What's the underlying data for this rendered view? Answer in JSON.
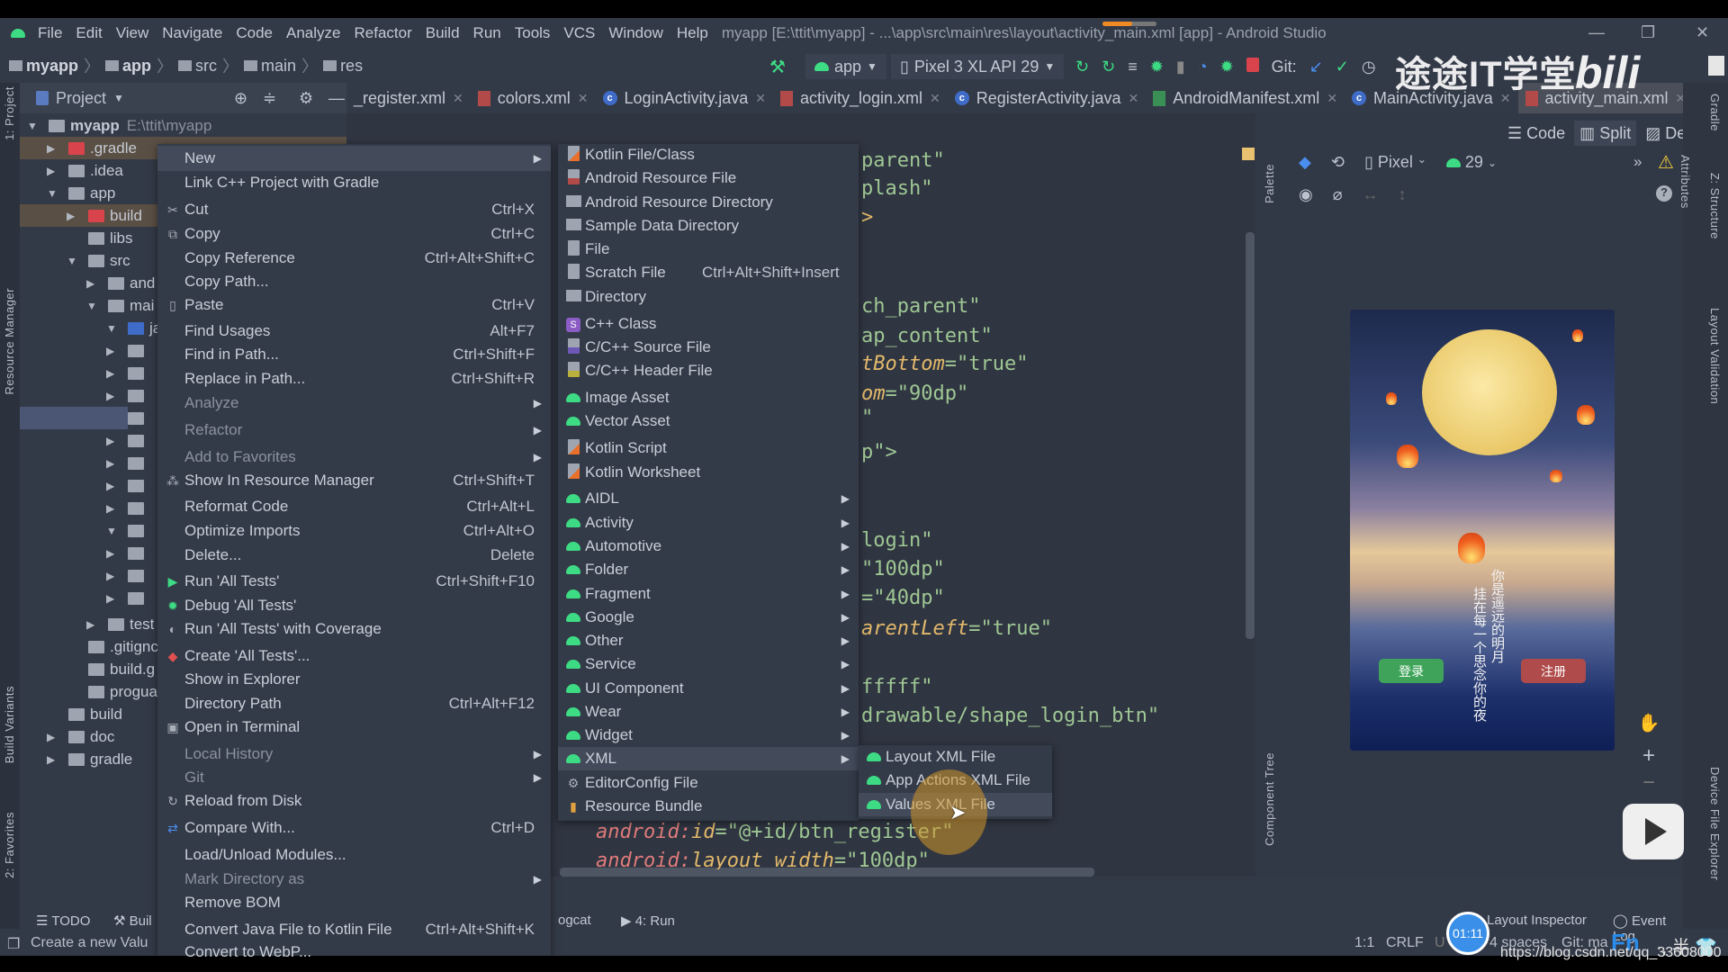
{
  "window": {
    "title": "myapp [E:\\ttit\\myapp] - ...\\app\\src\\main\\res\\layout\\activity_main.xml [app] - Android Studio",
    "controls": [
      "—",
      "❐",
      "✕"
    ]
  },
  "menubar": [
    "File",
    "Edit",
    "View",
    "Navigate",
    "Code",
    "Analyze",
    "Refactor",
    "Build",
    "Run",
    "Tools",
    "VCS",
    "Window",
    "Help"
  ],
  "breadcrumb": [
    "myapp",
    "app",
    "src",
    "main",
    "res"
  ],
  "toolbar": {
    "config": "app",
    "device": "Pixel 3 XL API 29",
    "git_label": "Git:"
  },
  "project_panel": {
    "title": "Project",
    "root_name": "myapp",
    "root_path": "E:\\ttit\\myapp",
    "tree": [
      ".gradle",
      ".idea",
      "app",
      "build",
      "libs",
      "src",
      "and",
      "mai",
      "ja",
      "test",
      ".gitignc",
      "build.g",
      "progua",
      "build",
      "doc",
      "gradle"
    ]
  },
  "tabs": [
    {
      "label": "_register.xml",
      "icon": "xml"
    },
    {
      "label": "colors.xml",
      "icon": "xml"
    },
    {
      "label": "LoginActivity.java",
      "icon": "class"
    },
    {
      "label": "activity_login.xml",
      "icon": "xml"
    },
    {
      "label": "RegisterActivity.java",
      "icon": "class"
    },
    {
      "label": "AndroidManifest.xml",
      "icon": "manifest"
    },
    {
      "label": "MainActivity.java",
      "icon": "class"
    },
    {
      "label": "activity_main.xml",
      "icon": "xml",
      "active": true
    }
  ],
  "context_menu": [
    {
      "label": "New",
      "submenu": true,
      "selected": true
    },
    {
      "label": "Link C++ Project with Gradle"
    },
    {
      "label": "Cut",
      "shortcut": "Ctrl+X",
      "icon": "scissors"
    },
    {
      "label": "Copy",
      "shortcut": "Ctrl+C",
      "icon": "copy"
    },
    {
      "label": "Copy Reference",
      "shortcut": "Ctrl+Alt+Shift+C"
    },
    {
      "label": "Copy Path..."
    },
    {
      "label": "Paste",
      "shortcut": "Ctrl+V",
      "icon": "clipboard"
    },
    {
      "label": "Find Usages",
      "shortcut": "Alt+F7"
    },
    {
      "label": "Find in Path...",
      "shortcut": "Ctrl+Shift+F"
    },
    {
      "label": "Replace in Path...",
      "shortcut": "Ctrl+Shift+R"
    },
    {
      "label": "Analyze",
      "submenu": true,
      "disabled": true
    },
    {
      "label": "Refactor",
      "submenu": true,
      "disabled": true
    },
    {
      "label": "Add to Favorites",
      "submenu": true,
      "disabled": true
    },
    {
      "label": "Show In Resource Manager",
      "shortcut": "Ctrl+Shift+T",
      "icon": "resource-manager"
    },
    {
      "label": "Reformat Code",
      "shortcut": "Ctrl+Alt+L"
    },
    {
      "label": "Optimize Imports",
      "shortcut": "Ctrl+Alt+O"
    },
    {
      "label": "Delete...",
      "shortcut": "Delete"
    },
    {
      "label": "Run 'All Tests'",
      "shortcut": "Ctrl+Shift+F10",
      "icon": "run"
    },
    {
      "label": "Debug 'All Tests'",
      "icon": "debug"
    },
    {
      "label": "Run 'All Tests' with Coverage",
      "icon": "coverage"
    },
    {
      "label": "Create 'All Tests'...",
      "icon": "create-test"
    },
    {
      "label": "Show in Explorer"
    },
    {
      "label": "Directory Path",
      "shortcut": "Ctrl+Alt+F12"
    },
    {
      "label": "Open in Terminal",
      "icon": "terminal"
    },
    {
      "label": "Local History",
      "submenu": true,
      "disabled": true
    },
    {
      "label": "Git",
      "submenu": true,
      "disabled": true
    },
    {
      "label": "Reload from Disk",
      "icon": "reload"
    },
    {
      "label": "Compare With...",
      "shortcut": "Ctrl+D",
      "icon": "compare"
    },
    {
      "label": "Load/Unload Modules..."
    },
    {
      "label": "Mark Directory as",
      "submenu": true,
      "disabled": true
    },
    {
      "label": "Remove BOM"
    },
    {
      "label": "Convert Java File to Kotlin File",
      "shortcut": "Ctrl+Alt+Shift+K"
    },
    {
      "label": "Convert to WebP..."
    }
  ],
  "new_submenu": [
    {
      "label": "Kotlin File/Class",
      "icon": "kotlin"
    },
    {
      "label": "Android Resource File",
      "icon": "xml"
    },
    {
      "label": "Android Resource Directory",
      "icon": "folder"
    },
    {
      "label": "Sample Data Directory",
      "icon": "folder"
    },
    {
      "label": "File",
      "icon": "file"
    },
    {
      "label": "Scratch File",
      "shortcut": "Ctrl+Alt+Shift+Insert",
      "icon": "scratch"
    },
    {
      "label": "Directory",
      "icon": "folder"
    },
    {
      "label": "C++ Class",
      "icon": "cpp-class"
    },
    {
      "label": "C/C++ Source File",
      "icon": "cpp"
    },
    {
      "label": "C/C++ Header File",
      "icon": "header"
    },
    {
      "label": "Image Asset",
      "icon": "android"
    },
    {
      "label": "Vector Asset",
      "icon": "android"
    },
    {
      "label": "Kotlin Script",
      "icon": "kotlin"
    },
    {
      "label": "Kotlin Worksheet",
      "icon": "kotlin"
    },
    {
      "label": "AIDL",
      "icon": "android",
      "submenu": true
    },
    {
      "label": "Activity",
      "icon": "android",
      "submenu": true
    },
    {
      "label": "Automotive",
      "icon": "android",
      "submenu": true
    },
    {
      "label": "Folder",
      "icon": "android",
      "submenu": true
    },
    {
      "label": "Fragment",
      "icon": "android",
      "submenu": true
    },
    {
      "label": "Google",
      "icon": "android",
      "submenu": true
    },
    {
      "label": "Other",
      "icon": "android",
      "submenu": true
    },
    {
      "label": "Service",
      "icon": "android",
      "submenu": true
    },
    {
      "label": "UI Component",
      "icon": "android",
      "submenu": true
    },
    {
      "label": "Wear",
      "icon": "android",
      "submenu": true
    },
    {
      "label": "Widget",
      "icon": "android",
      "submenu": true
    },
    {
      "label": "XML",
      "icon": "android",
      "submenu": true,
      "selected": true
    },
    {
      "label": "EditorConfig File",
      "icon": "gear"
    },
    {
      "label": "Resource Bundle",
      "icon": "bundle"
    }
  ],
  "xml_submenu": [
    {
      "label": "Layout XML File"
    },
    {
      "label": "App Actions XML File"
    },
    {
      "label": "Values XML File",
      "selected": true
    }
  ],
  "code_fragments": [
    [
      "parent\""
    ],
    [
      "plash\""
    ],
    [
      ">"
    ],
    [
      "ch_parent\""
    ],
    [
      "ap_content\""
    ],
    [
      "tBottom",
      "=\"true\""
    ],
    [
      "om",
      "=\"90dp\""
    ],
    [
      "\""
    ],
    [
      "p\">"
    ],
    [
      "login\""
    ],
    [
      "\"100dp\""
    ],
    [
      "=\"40dp\""
    ],
    [
      "arentLeft",
      "=\"true\""
    ],
    [
      "fffff\""
    ],
    [
      "drawable/shape_login_btn\""
    ]
  ],
  "code_lines_full": [
    {
      "ns": "android:",
      "attr": "id",
      "val": "=\"@+id/btn_register\""
    },
    {
      "ns": "android:",
      "attr": "layout_width",
      "val": "=\"100dp\""
    }
  ],
  "design": {
    "modes": [
      "Code",
      "Split",
      "Design"
    ],
    "active_mode": "Split",
    "device": "Pixel",
    "api": "29",
    "palette": "Palette",
    "attributes": "Attributes",
    "component_tree": "Component Tree",
    "preview": {
      "login_button": "登录",
      "register_button": "注册",
      "poem_line1": "你是遥远的明月",
      "poem_line2": "挂在每一个思念你的夜",
      "login_color": "#3fa45a",
      "register_color": "#b04b4b"
    }
  },
  "side_tools": {
    "left": [
      "1: Project",
      "Resource Manager",
      "Build Variants",
      "2: Favorites"
    ],
    "right": [
      "Gradle",
      "Z: Structure",
      "Layout Validation",
      "Device File Explorer"
    ]
  },
  "bottom_tools": [
    "TODO",
    "Buil",
    "ogcat",
    "4: Run",
    "Layout Inspector",
    "Event Log"
  ],
  "status": {
    "message": "Create a new Valu",
    "position": "1:1",
    "line_sep": "CRLF",
    "encoding": "U",
    "indent": "4 spaces",
    "git": "Git: ma"
  },
  "overlays": {
    "watermark_cn": "途途IT学堂",
    "watermark_logo": "bilibili",
    "timer": "01:11",
    "csdn_url": "https://blog.csdn.net/qq_33608000",
    "ime": "Fn"
  },
  "colors": {
    "accent": "#3ddc84",
    "background": "#333a47",
    "menu": "#343b48",
    "selection": "#434b5b"
  }
}
